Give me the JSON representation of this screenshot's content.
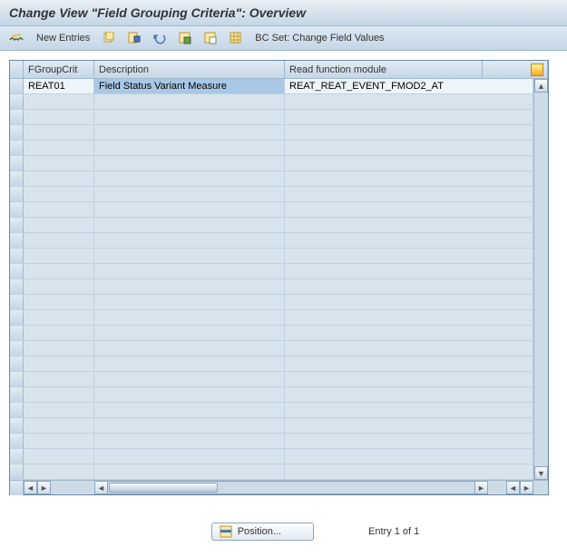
{
  "title": "Change View \"Field Grouping Criteria\": Overview",
  "toolbar": {
    "new_entries": "New Entries",
    "bc_set": "BC Set: Change Field Values"
  },
  "columns": {
    "c1": "FGroupCrit",
    "c2": "Description",
    "c3": "Read function module"
  },
  "rows": [
    {
      "c1": "REAT01",
      "c2": "Field Status Variant Measure",
      "c3": "REAT_REAT_EVENT_FMOD2_AT"
    }
  ],
  "empty_row_count": 25,
  "footer": {
    "position": "Position...",
    "entry": "Entry 1 of 1"
  }
}
